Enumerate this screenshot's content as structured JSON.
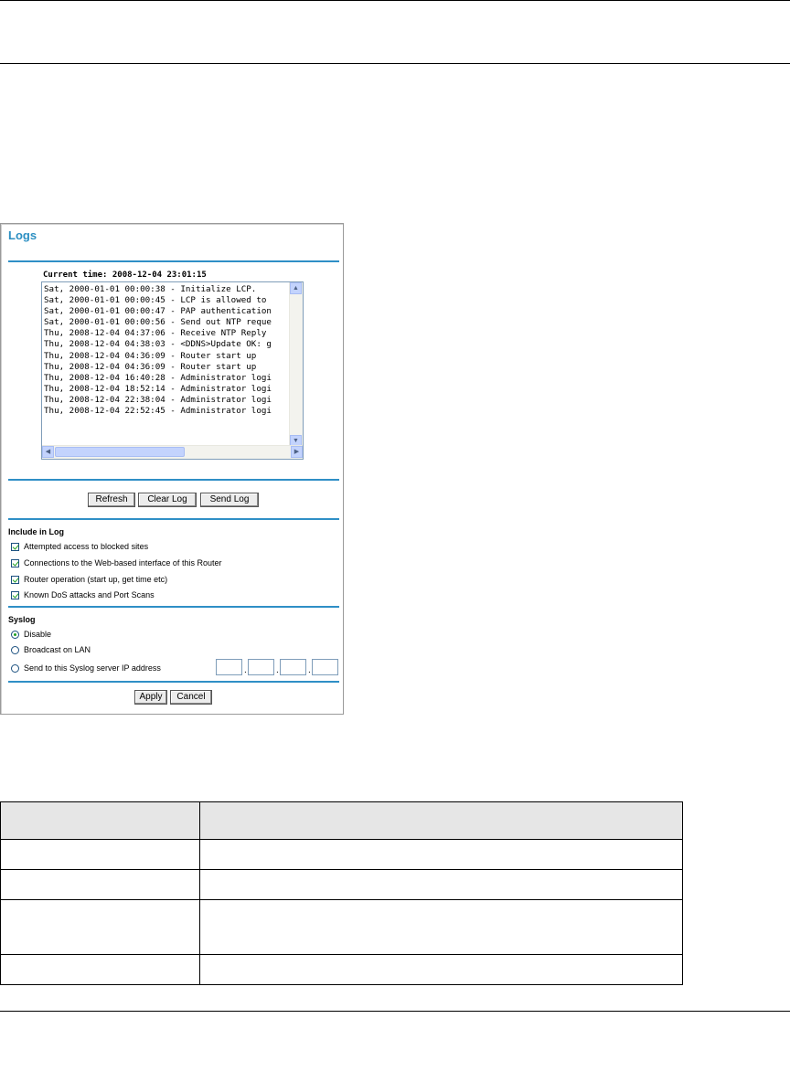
{
  "panel": {
    "title": "Logs",
    "current_time": "Current time: 2008-12-04 23:01:15",
    "log_lines": [
      "Sat, 2000-01-01 00:00:38 - Initialize LCP.",
      "Sat, 2000-01-01 00:00:45 - LCP is allowed to",
      "Sat, 2000-01-01 00:00:47 - PAP authentication",
      "Sat, 2000-01-01 00:00:56 - Send out NTP reque",
      "Thu, 2008-12-04 04:37:06 - Receive NTP Reply",
      "Thu, 2008-12-04 04:38:03 - <DDNS>Update OK: g",
      "Thu, 2008-12-04 04:36:09 - Router start up",
      "Thu, 2008-12-04 04:36:09 - Router start up",
      "Thu, 2008-12-04 16:40:28 - Administrator logi",
      "Thu, 2008-12-04 18:52:14 - Administrator logi",
      "Thu, 2008-12-04 22:38:04 - Administrator logi",
      "Thu, 2008-12-04 22:52:45 - Administrator logi"
    ],
    "buttons": {
      "refresh": "Refresh",
      "clear_log": "Clear Log",
      "send_log": "Send Log"
    },
    "include_in_log": {
      "label": "Include in Log",
      "options": [
        {
          "label": "Attempted access to blocked sites",
          "checked": true
        },
        {
          "label": "Connections to the Web-based interface of this Router",
          "checked": true
        },
        {
          "label": "Router operation (start up, get time etc)",
          "checked": true
        },
        {
          "label": "Known DoS attacks and Port Scans",
          "checked": true
        }
      ]
    },
    "syslog": {
      "label": "Syslog",
      "options": [
        {
          "label": "Disable",
          "selected": true
        },
        {
          "label": "Broadcast on LAN",
          "selected": false
        },
        {
          "label": "Send to this Syslog server IP address",
          "selected": false
        }
      ],
      "ip_octets": [
        "",
        "",
        "",
        ""
      ]
    },
    "footer_buttons": {
      "apply": "Apply",
      "cancel": "Cancel"
    }
  },
  "table": {
    "header": [
      "",
      ""
    ],
    "rows": [
      [
        "",
        ""
      ],
      [
        "",
        ""
      ],
      [
        "",
        ""
      ],
      [
        "",
        ""
      ]
    ]
  }
}
